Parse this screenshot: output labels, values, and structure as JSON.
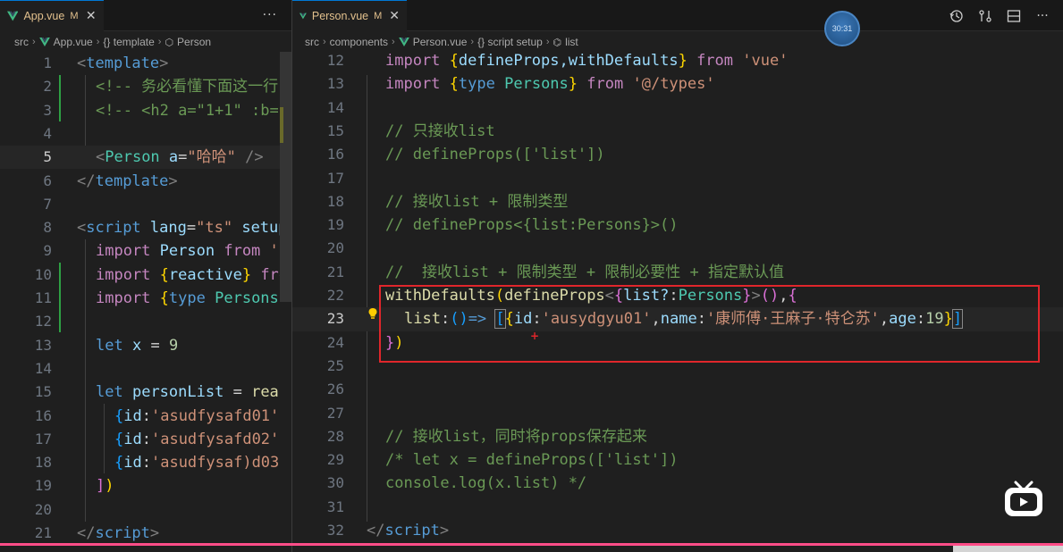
{
  "left": {
    "tab": {
      "name": "App.vue",
      "modified": "M",
      "close": "✕"
    },
    "more": "···",
    "breadcrumb": {
      "src": "src",
      "file": "App.vue",
      "section": "{} template",
      "node": "Person"
    },
    "lines": [
      {
        "n": "1"
      },
      {
        "n": "2"
      },
      {
        "n": "3"
      },
      {
        "n": "4"
      },
      {
        "n": "5"
      },
      {
        "n": "6"
      },
      {
        "n": "7"
      },
      {
        "n": "8"
      },
      {
        "n": "9"
      },
      {
        "n": "10"
      },
      {
        "n": "11"
      },
      {
        "n": "12"
      },
      {
        "n": "13"
      },
      {
        "n": "14"
      },
      {
        "n": "15"
      },
      {
        "n": "16"
      },
      {
        "n": "17"
      },
      {
        "n": "18"
      },
      {
        "n": "19"
      },
      {
        "n": "20"
      },
      {
        "n": "21"
      }
    ],
    "code": {
      "l1": "template",
      "l2": "<!-- 务必看懂下面这一行",
      "l3": "<!-- <h2 a=\"1+1\" :b=\"",
      "l5_tag": "Person",
      "l5_attr": "a",
      "l5_val": "\"哈哈\"",
      "l6": "template",
      "l8_tag": "script",
      "l8_attr": "lang",
      "l8_val": "\"ts\"",
      "l8_tail": "setup",
      "l9_kw": "import",
      "l9_id": "Person",
      "l9_from": "from",
      "l9_str": "'.",
      "l10_kw": "import",
      "l10_id": "reactive",
      "l10_from": "fro",
      "l11_kw": "import",
      "l11_type": "type",
      "l11_id": "Persons",
      "l13_kw": "let",
      "l13_var": "x",
      "l13_num": "9",
      "l15_kw": "let",
      "l15_var": "personList",
      "l15_fn": "reac",
      "l16_key": "id",
      "l16_str": "'asudfysafd01'",
      "l17_key": "id",
      "l17_str": "'asudfysafd02'",
      "l18_key": "id",
      "l18_str": "'asudfysaf)d03'",
      "l21": "script"
    }
  },
  "right": {
    "tab": {
      "name": "Person.vue",
      "modified": "M",
      "close": "✕"
    },
    "timer": "30:31",
    "breadcrumb": {
      "src": "src",
      "dir": "components",
      "file": "Person.vue",
      "section": "{} script setup",
      "node": "list"
    },
    "lines": [
      {
        "n": "12"
      },
      {
        "n": "13"
      },
      {
        "n": "14"
      },
      {
        "n": "15"
      },
      {
        "n": "16"
      },
      {
        "n": "17"
      },
      {
        "n": "18"
      },
      {
        "n": "19"
      },
      {
        "n": "20"
      },
      {
        "n": "21"
      },
      {
        "n": "22"
      },
      {
        "n": "23"
      },
      {
        "n": "24"
      },
      {
        "n": "25"
      },
      {
        "n": "26"
      },
      {
        "n": "27"
      },
      {
        "n": "28"
      },
      {
        "n": "29"
      },
      {
        "n": "30"
      },
      {
        "n": "31"
      },
      {
        "n": "32"
      }
    ],
    "code": {
      "l12_kw": "import",
      "l12_ids": "defineProps,withDefaults",
      "l12_from": "from",
      "l12_str": "'vue'",
      "l13_kw": "import",
      "l13_type": "type",
      "l13_id": "Persons",
      "l13_from": "from",
      "l13_str": "'@/types'",
      "l15": "// 只接收list",
      "l16": "// defineProps(['list'])",
      "l18": "// 接收list + 限制类型",
      "l19": "// defineProps<{list:Persons}>()",
      "l21": "//  接收list + 限制类型 + 限制必要性 + 指定默认值",
      "l22_fn1": "withDefaults",
      "l22_fn2": "defineProps",
      "l22_prop": "list?",
      "l22_type": "Persons",
      "l23_key": "list",
      "l23_id_key": "id",
      "l23_id_val": "'ausydgyu01'",
      "l23_name_key": "name",
      "l23_name_val": "'康师傅·王麻子·特仑苏'",
      "l23_age_key": "age",
      "l23_age_val": "19",
      "l28": "// 接收list，同时将props保存起来",
      "l29": "/* let x = defineProps(['list'])",
      "l30": "console.log(x.list) */",
      "l32": "script"
    }
  },
  "colors": {
    "keyword": "#569cd6",
    "control": "#c586c0",
    "string": "#ce9178",
    "comment": "#6a9955",
    "variable": "#9cdcfe",
    "function": "#dcdcaa",
    "type": "#4ec9b0",
    "highlight_box": "#e0262b",
    "modified_tab": "#e2c08d"
  },
  "icons": [
    "vue-file-icon",
    "close-icon",
    "more-actions-icon",
    "timeline-icon",
    "compare-changes-icon",
    "split-editor-icon",
    "more-icon",
    "lightbulb-icon",
    "bilibili-tv-icon"
  ]
}
